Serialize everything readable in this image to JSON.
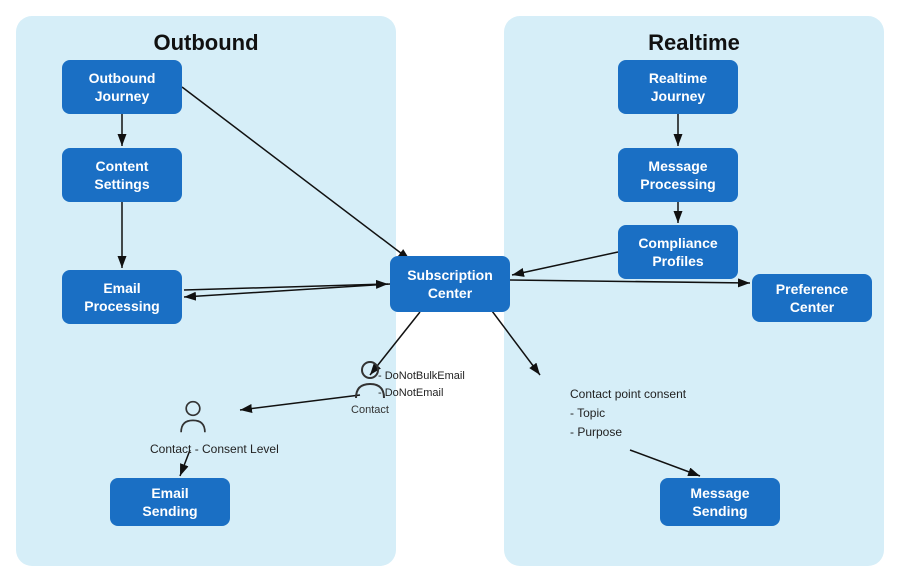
{
  "panels": {
    "outbound": {
      "title": "Outbound"
    },
    "realtime": {
      "title": "Realtime"
    }
  },
  "boxes": {
    "outbound_journey": "Outbound\nJourney",
    "content_settings": "Content\nSettings",
    "email_processing": "Email\nProcessing",
    "email_sending": "Email\nSending",
    "subscription_center": "Subscription\nCenter",
    "realtime_journey": "Realtime\nJourney",
    "message_processing": "Message\nProcessing",
    "compliance_profiles": "Compliance\nProfiles",
    "preference_center": "Preference\nCenter",
    "message_sending": "Message\nSending"
  },
  "contact_center_label": "Contact",
  "contact_fields": [
    "DoNotBulkEmail",
    "DoNotEmail"
  ],
  "contact_left_label": "Contact -  Consent Level",
  "contact_right_labels": [
    "Contact point consent",
    "Topic",
    "Purpose"
  ]
}
